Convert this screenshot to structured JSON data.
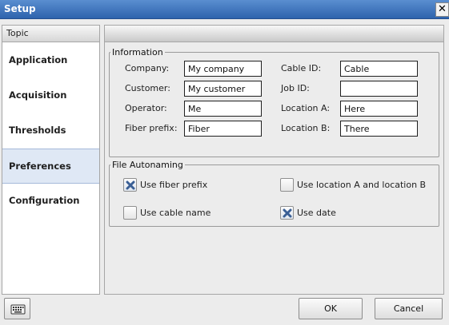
{
  "window": {
    "title": "Setup",
    "close_glyph": "✕"
  },
  "sidebar": {
    "header": "Topic",
    "items": [
      {
        "label": "Application",
        "selected": false
      },
      {
        "label": "Acquisition",
        "selected": false
      },
      {
        "label": "Thresholds",
        "selected": false
      },
      {
        "label": "Preferences",
        "selected": true
      },
      {
        "label": "Configuration",
        "selected": false
      }
    ]
  },
  "information": {
    "legend": "Information",
    "company_label": "Company:",
    "company_value": "My company",
    "customer_label": "Customer:",
    "customer_value": "My customer",
    "operator_label": "Operator:",
    "operator_value": "Me",
    "fiber_prefix_label": "Fiber prefix:",
    "fiber_prefix_value": "Fiber",
    "cable_id_label": "Cable ID:",
    "cable_id_value": "Cable",
    "job_id_label": "Job ID:",
    "job_id_value": "",
    "location_a_label": "Location A:",
    "location_a_value": "Here",
    "location_b_label": "Location B:",
    "location_b_value": "There"
  },
  "autonaming": {
    "legend": "File Autonaming",
    "use_fiber_prefix": {
      "label": "Use fiber prefix",
      "checked": true
    },
    "use_location": {
      "label": "Use location A and location B",
      "checked": false
    },
    "use_cable_name": {
      "label": "Use cable name",
      "checked": false
    },
    "use_date": {
      "label": "Use date",
      "checked": true
    }
  },
  "buttons": {
    "ok": "OK",
    "cancel": "Cancel",
    "keyboard_icon": "keyboard-icon"
  },
  "colors": {
    "titlebar": "#2d63ad",
    "selected_item": "#dfe8f5",
    "check_mark": "#3a5f95"
  }
}
